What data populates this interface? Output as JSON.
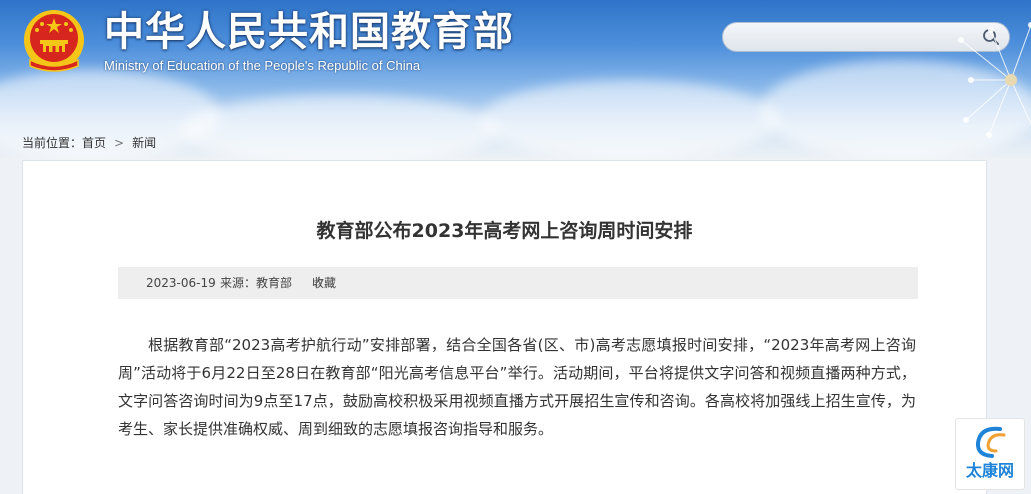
{
  "header": {
    "title_cn": "中华人民共和国教育部",
    "title_en": "Ministry of Education of the People's Republic of China",
    "search_placeholder": ""
  },
  "breadcrumb": {
    "prefix": "当前位置：",
    "home": "首页",
    "separator": ">",
    "current": "新闻"
  },
  "article": {
    "title": "教育部公布2023年高考网上咨询周时间安排",
    "date": "2023-06-19",
    "source": "来源：教育部",
    "favorite": "收藏",
    "body": "根据教育部“2023高考护航行动”安排部署，结合全国各省(区、市)高考志愿填报时间安排，“2023年高考网上咨询周”活动将于6月22日至28日在教育部“阳光高考信息平台”举行。活动期间，平台将提供文字问答和视频直播两种方式，文字问答咨询时间为9点至17点，鼓励高校积极采用视频直播方式开展招生宣传和咨询。各高校将加强线上招生宣传，为考生、家长提供准确权威、周到细致的志愿填报咨询指导和服务。"
  },
  "watermark": {
    "text": "太康网"
  },
  "colors": {
    "sky_top": "#2f74c9",
    "emblem_red": "#d7261e",
    "emblem_gold": "#f5c518",
    "watermark_blue": "#1f84d8"
  }
}
